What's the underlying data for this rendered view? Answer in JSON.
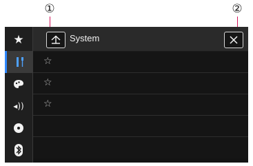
{
  "callouts": {
    "first": "①",
    "second": "②"
  },
  "header": {
    "title": "System"
  },
  "sidebar": {
    "items": [
      {
        "name": "favorites",
        "icon": "star-icon",
        "glyph": "★",
        "active": false
      },
      {
        "name": "settings",
        "icon": "tools-icon",
        "glyph": "",
        "active": true
      },
      {
        "name": "theme",
        "icon": "palette-icon",
        "glyph": "",
        "active": false
      },
      {
        "name": "audio",
        "icon": "speaker-icon",
        "glyph": "◂))",
        "active": false
      },
      {
        "name": "video",
        "icon": "disc-icon",
        "glyph": "",
        "active": false
      },
      {
        "name": "bluetooth",
        "icon": "bluetooth-icon",
        "glyph": "",
        "active": false
      }
    ]
  },
  "list": {
    "rows": [
      {
        "star": "☆",
        "label": ""
      },
      {
        "star": "☆",
        "label": ""
      },
      {
        "star": "☆",
        "label": ""
      },
      {
        "star": "",
        "label": ""
      },
      {
        "star": "",
        "label": ""
      }
    ]
  },
  "colors": {
    "accent": "#2f88ff",
    "leader": "#d4145a",
    "background": "#131313"
  }
}
